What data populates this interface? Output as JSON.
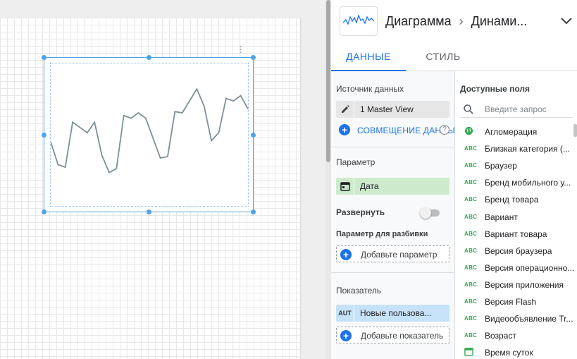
{
  "header": {
    "crumb_1": "Диаграмма",
    "separator": "›",
    "crumb_2": "Динами..."
  },
  "tabs": [
    {
      "label": "ДАННЫЕ",
      "active": true
    },
    {
      "label": "СТИЛЬ",
      "active": false
    }
  ],
  "data_panel": {
    "source_label": "Источник данных",
    "source_value": "1 Master View",
    "blend_label": "СОВМЕЩЕНИЕ ДАННЫХ",
    "parameter_label": "Параметр",
    "parameter_value": "Дата",
    "expand_label": "Развернуть",
    "expand_on": false,
    "breakdown_label": "Параметр для разбивки",
    "add_parameter": "Добавьте параметр",
    "metric_label": "Показатель",
    "metric_type": "AUT",
    "metric_value": "Новые пользова...",
    "add_metric": "Добавьте показатель"
  },
  "fields_panel": {
    "title": "Доступные поля",
    "search_placeholder": "Введите запрос",
    "fields": [
      {
        "type": "geo",
        "name": "Агломерация"
      },
      {
        "type": "ABC",
        "name": "Близкая категория (..."
      },
      {
        "type": "ABC",
        "name": "Браузер"
      },
      {
        "type": "ABC",
        "name": "Бренд мобильного у..."
      },
      {
        "type": "ABC",
        "name": "Бренд товара"
      },
      {
        "type": "ABC",
        "name": "Вариант"
      },
      {
        "type": "ABC",
        "name": "Вариант товара"
      },
      {
        "type": "ABC",
        "name": "Версия браузера"
      },
      {
        "type": "ABC",
        "name": "Версия операционно..."
      },
      {
        "type": "ABC",
        "name": "Версия приложения"
      },
      {
        "type": "ABC",
        "name": "Версия Flash"
      },
      {
        "type": "ABC",
        "name": "Видеообъявление Tr..."
      },
      {
        "type": "ABC",
        "name": "Возраст"
      },
      {
        "type": "date",
        "name": "Время суток"
      }
    ]
  },
  "chart_data": {
    "type": "line",
    "title": "",
    "xlabel": "",
    "ylabel": "",
    "grid": false,
    "series": [
      {
        "values": [
          45,
          28,
          26,
          60,
          56,
          52,
          60,
          35,
          22,
          25,
          65,
          63,
          67,
          63,
          48,
          33,
          34,
          68,
          67,
          76,
          85,
          72,
          46,
          52,
          78,
          76,
          80,
          70
        ]
      }
    ],
    "ylim": [
      0,
      100
    ]
  },
  "colors": {
    "accent": "#1a73e8",
    "selection": "#4fa3e8",
    "line": "#7c8f96",
    "dimension_chip": "#cdeacd",
    "metric_chip": "#c6e2f8"
  }
}
